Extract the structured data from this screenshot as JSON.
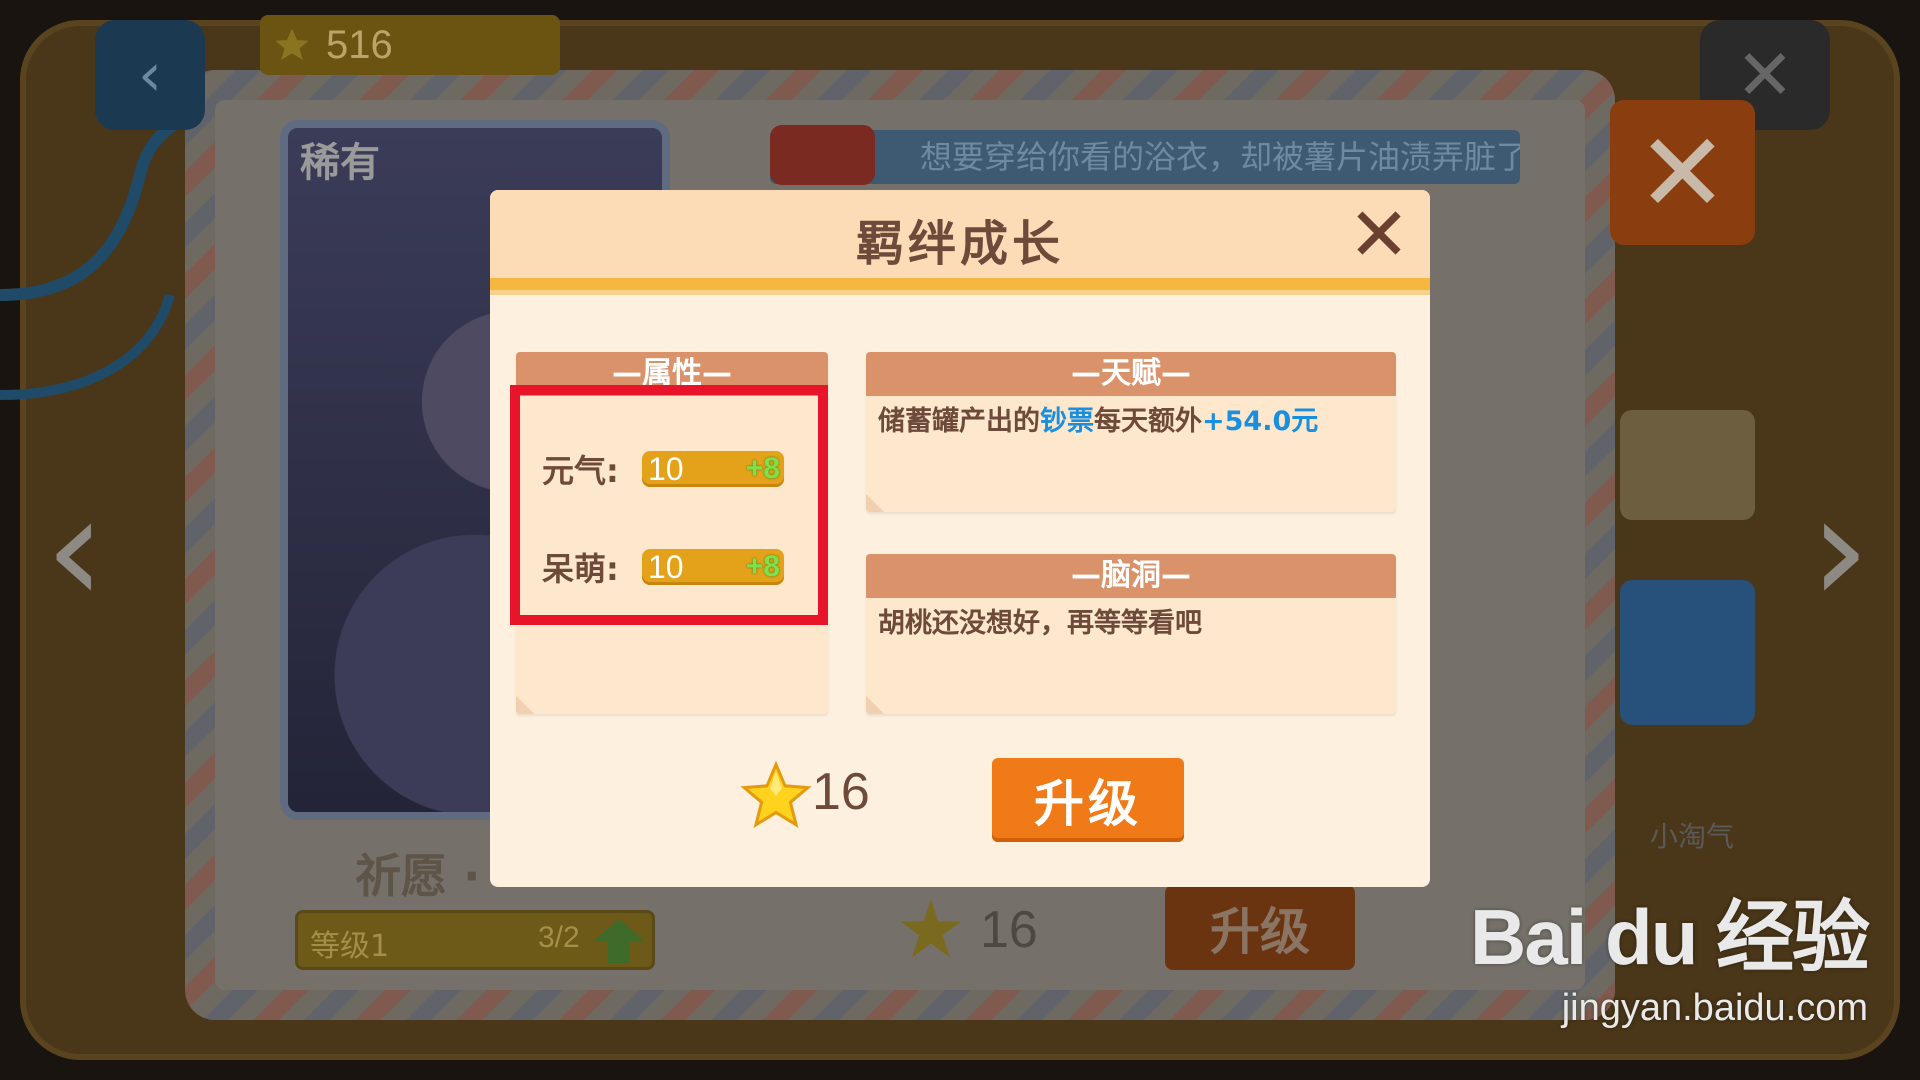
{
  "top_bar": {
    "star_count": "516"
  },
  "card": {
    "rarity": "稀有",
    "name": "祈愿 · ",
    "level_label": "等级1",
    "level_progress": "3/2"
  },
  "story": {
    "text": "想要穿给你看的浴衣，却被薯片油渍弄脏了"
  },
  "background_bottom": {
    "star_cost": "16",
    "upgrade_label": "升级",
    "side_name": "小淘气"
  },
  "dialog": {
    "title": "羁绊成长",
    "attributes": {
      "header": "—属性—",
      "rows": [
        {
          "label": "元气:",
          "value": "10",
          "bonus": "+8"
        },
        {
          "label": "呆萌:",
          "value": "10",
          "bonus": "+8"
        }
      ]
    },
    "talent": {
      "header": "—天赋—",
      "text_part1": "储蓄罐产出的",
      "text_highlight1": "钞票",
      "text_part2": "每天额外",
      "text_highlight2": "+54.0元"
    },
    "brain": {
      "header": "—脑洞—",
      "text": "胡桃还没想好，再等等看吧"
    },
    "cost": {
      "star_cost": "16"
    },
    "upgrade_label": "升级"
  },
  "watermark": {
    "logo": "Bai du 经验",
    "sub": "jingyan.baidu.com"
  },
  "colors": {
    "accent_orange": "#f17a18",
    "highlight_red": "#e8152a",
    "highlight_blue": "#1a8fe0",
    "header_gold": "#f6b741"
  }
}
